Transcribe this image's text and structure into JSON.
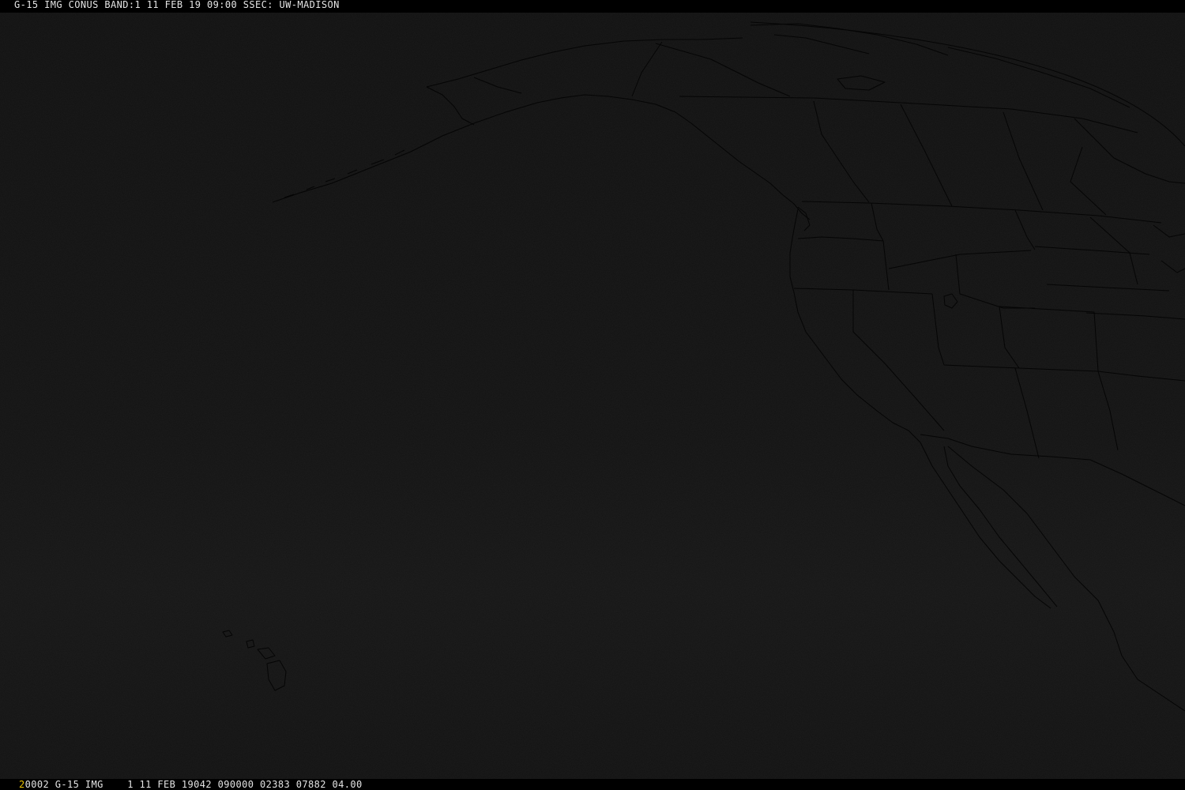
{
  "header": {
    "title": "G-15 IMG CONUS BAND:1 11 FEB 19 09:00 SSEC: UW-MADISON"
  },
  "footer": {
    "frame_number": "2",
    "info": "0002 G-15 IMG    1 11 FEB 19042 090000 02383 07882 04.00"
  },
  "colors": {
    "background": "#000000",
    "image_dark": "#121212",
    "text": "#e4e4e4",
    "frame_number": "#e8c000",
    "map_lines": "#050505"
  },
  "map": {
    "type": "satellite-visible",
    "features": [
      "coastlines",
      "state-boundaries",
      "province-boundaries",
      "country-borders",
      "hawaii-islands"
    ]
  }
}
